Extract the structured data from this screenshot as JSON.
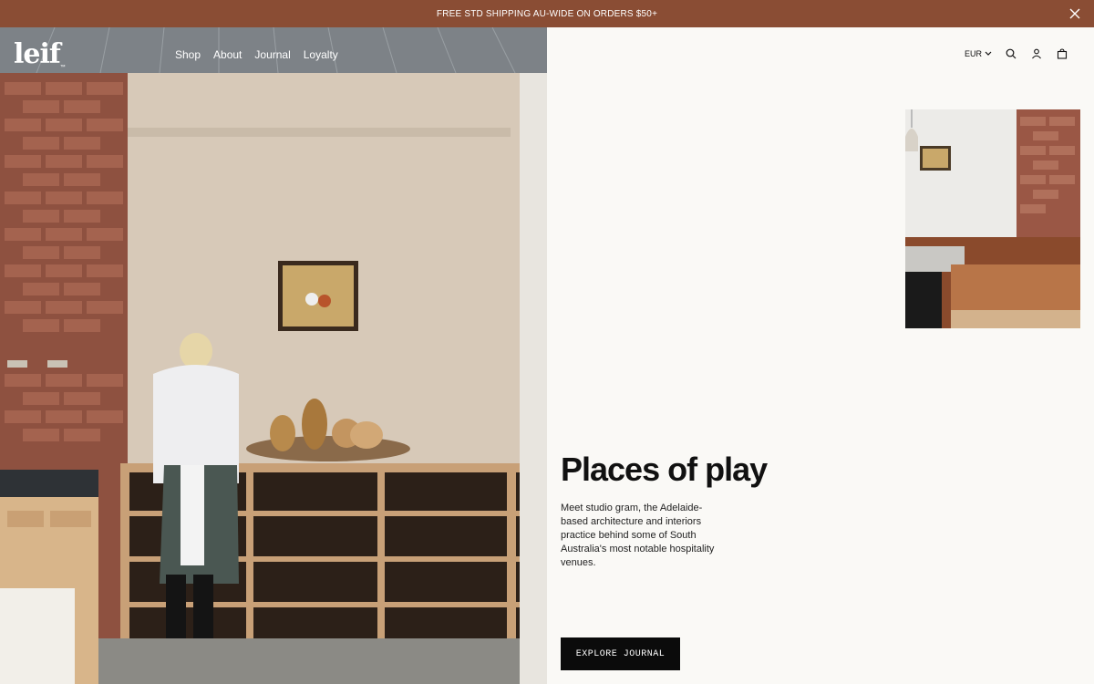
{
  "announcement": {
    "text": "FREE STD SHIPPING AU-WIDE ON ORDERS $50+"
  },
  "header": {
    "logo_text": "leif",
    "logo_tm": "™",
    "nav": [
      {
        "label": "Shop"
      },
      {
        "label": "About"
      },
      {
        "label": "Journal"
      },
      {
        "label": "Loyalty"
      }
    ],
    "currency": "EUR",
    "icons": [
      "search-icon",
      "account-icon",
      "cart-icon"
    ]
  },
  "feature": {
    "title": "Places of play",
    "description": "Meet studio gram, the Adelaide-based architecture and interiors practice behind some of South Australia's most notable hospitality venues.",
    "cta_label": "EXPLORE JOURNAL"
  },
  "colors": {
    "announcement_bg": "#8a4d34",
    "page_bg": "#faf9f6",
    "cta_bg": "#0b0b0b"
  }
}
